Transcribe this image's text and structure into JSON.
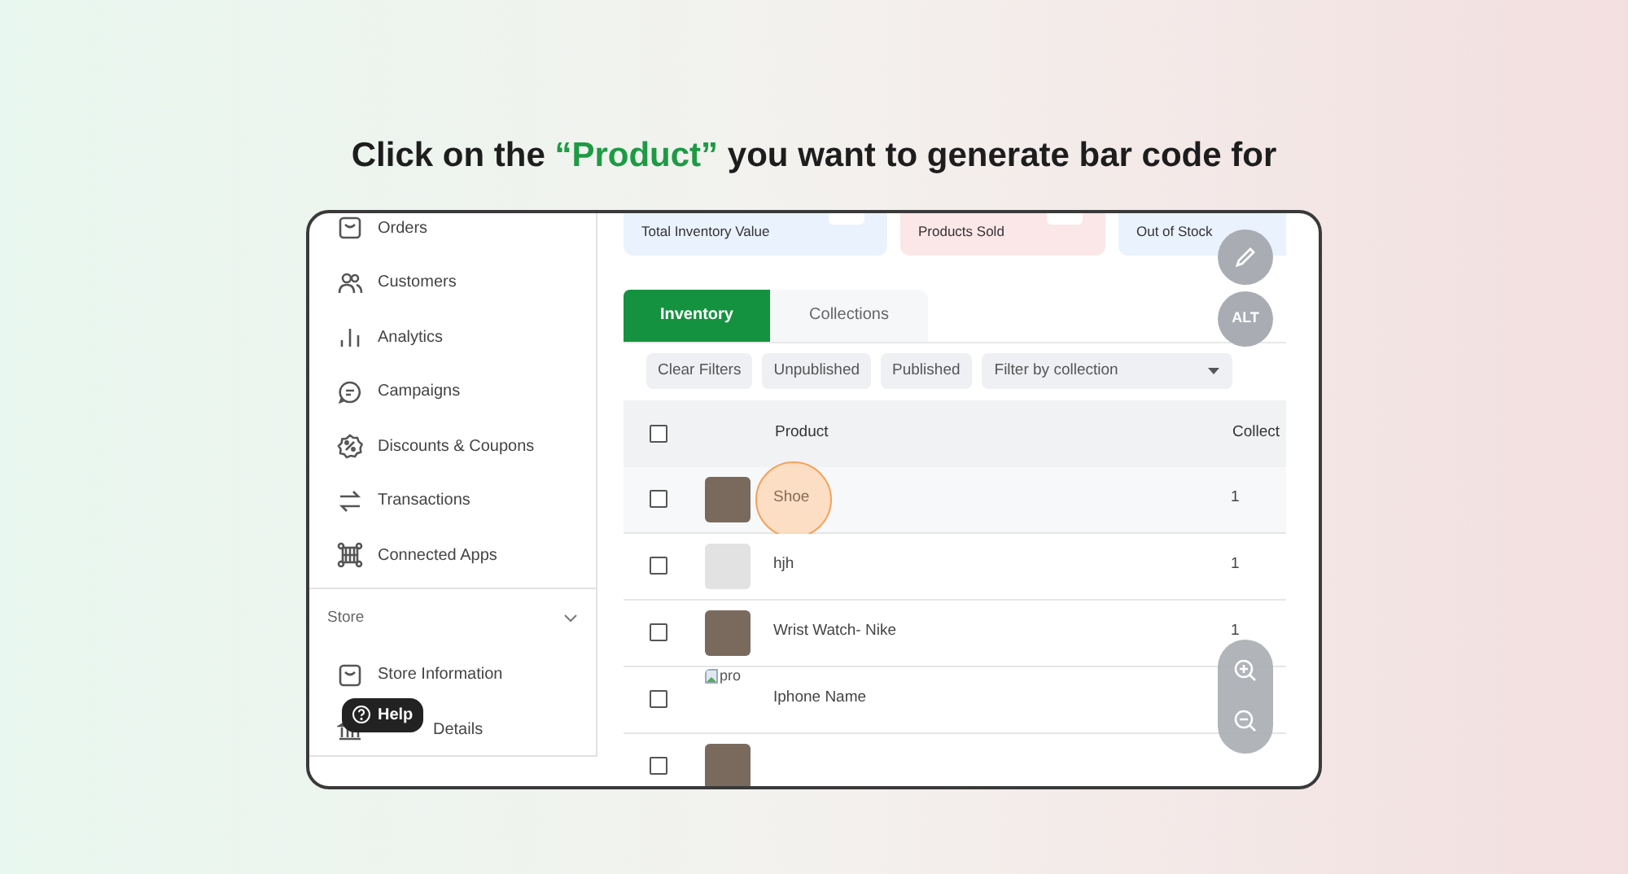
{
  "heading": [
    {
      "text": "Click on the ",
      "highlight": false
    },
    {
      "text": "“Product”",
      "highlight": true
    },
    {
      "text": " you want to generate bar code for",
      "highlight": false
    }
  ],
  "sidebar": {
    "items": [
      {
        "label": "Orders",
        "kind": "bag"
      },
      {
        "label": "Customers",
        "kind": "people"
      },
      {
        "label": "Analytics",
        "kind": "bars"
      },
      {
        "label": "Campaigns",
        "kind": "chat"
      },
      {
        "label": "Discounts & Coupons",
        "kind": "discount"
      },
      {
        "label": "Transactions",
        "kind": "swap"
      },
      {
        "label": "Connected Apps",
        "kind": "network"
      }
    ],
    "section": {
      "label": "Store",
      "expanded": true
    },
    "section_items": [
      {
        "label": "Store Information",
        "kind": "bag"
      },
      {
        "label": "Details",
        "kind": "bank"
      }
    ],
    "help_button": "Help"
  },
  "stat_cards": [
    {
      "label": "Total Inventory Value",
      "color": "#eaf2fd"
    },
    {
      "label": "Products Sold",
      "color": "#fbe6e8"
    },
    {
      "label": "Out of Stock",
      "color": "#eaf2fd"
    }
  ],
  "tabs": [
    {
      "label": "Inventory",
      "selected": true
    },
    {
      "label": "Collections",
      "selected": false
    }
  ],
  "filters": [
    "Clear Filters",
    "Unpublished",
    "Published"
  ],
  "collection_filter": {
    "placeholder": "Filter by collection"
  },
  "table": {
    "columns": [
      "Product",
      "Collect"
    ],
    "header_checked": false,
    "rows": [
      {
        "kind": "photo",
        "product": "Shoe",
        "collections": "1",
        "checked": false,
        "selected": true
      },
      {
        "kind": "blank",
        "product": "hjh",
        "collections": "1",
        "checked": false,
        "selected": false
      },
      {
        "kind": "photo",
        "product": "Wrist Watch- Nike",
        "collections": "1",
        "checked": false,
        "selected": false
      },
      {
        "kind": "broken",
        "image_alt": "pro",
        "product": "Iphone Name",
        "checked": false,
        "selected": false
      },
      {
        "kind": "photo",
        "checked": false,
        "selected": false
      }
    ]
  },
  "floating": {
    "alt_button": "ALT"
  }
}
